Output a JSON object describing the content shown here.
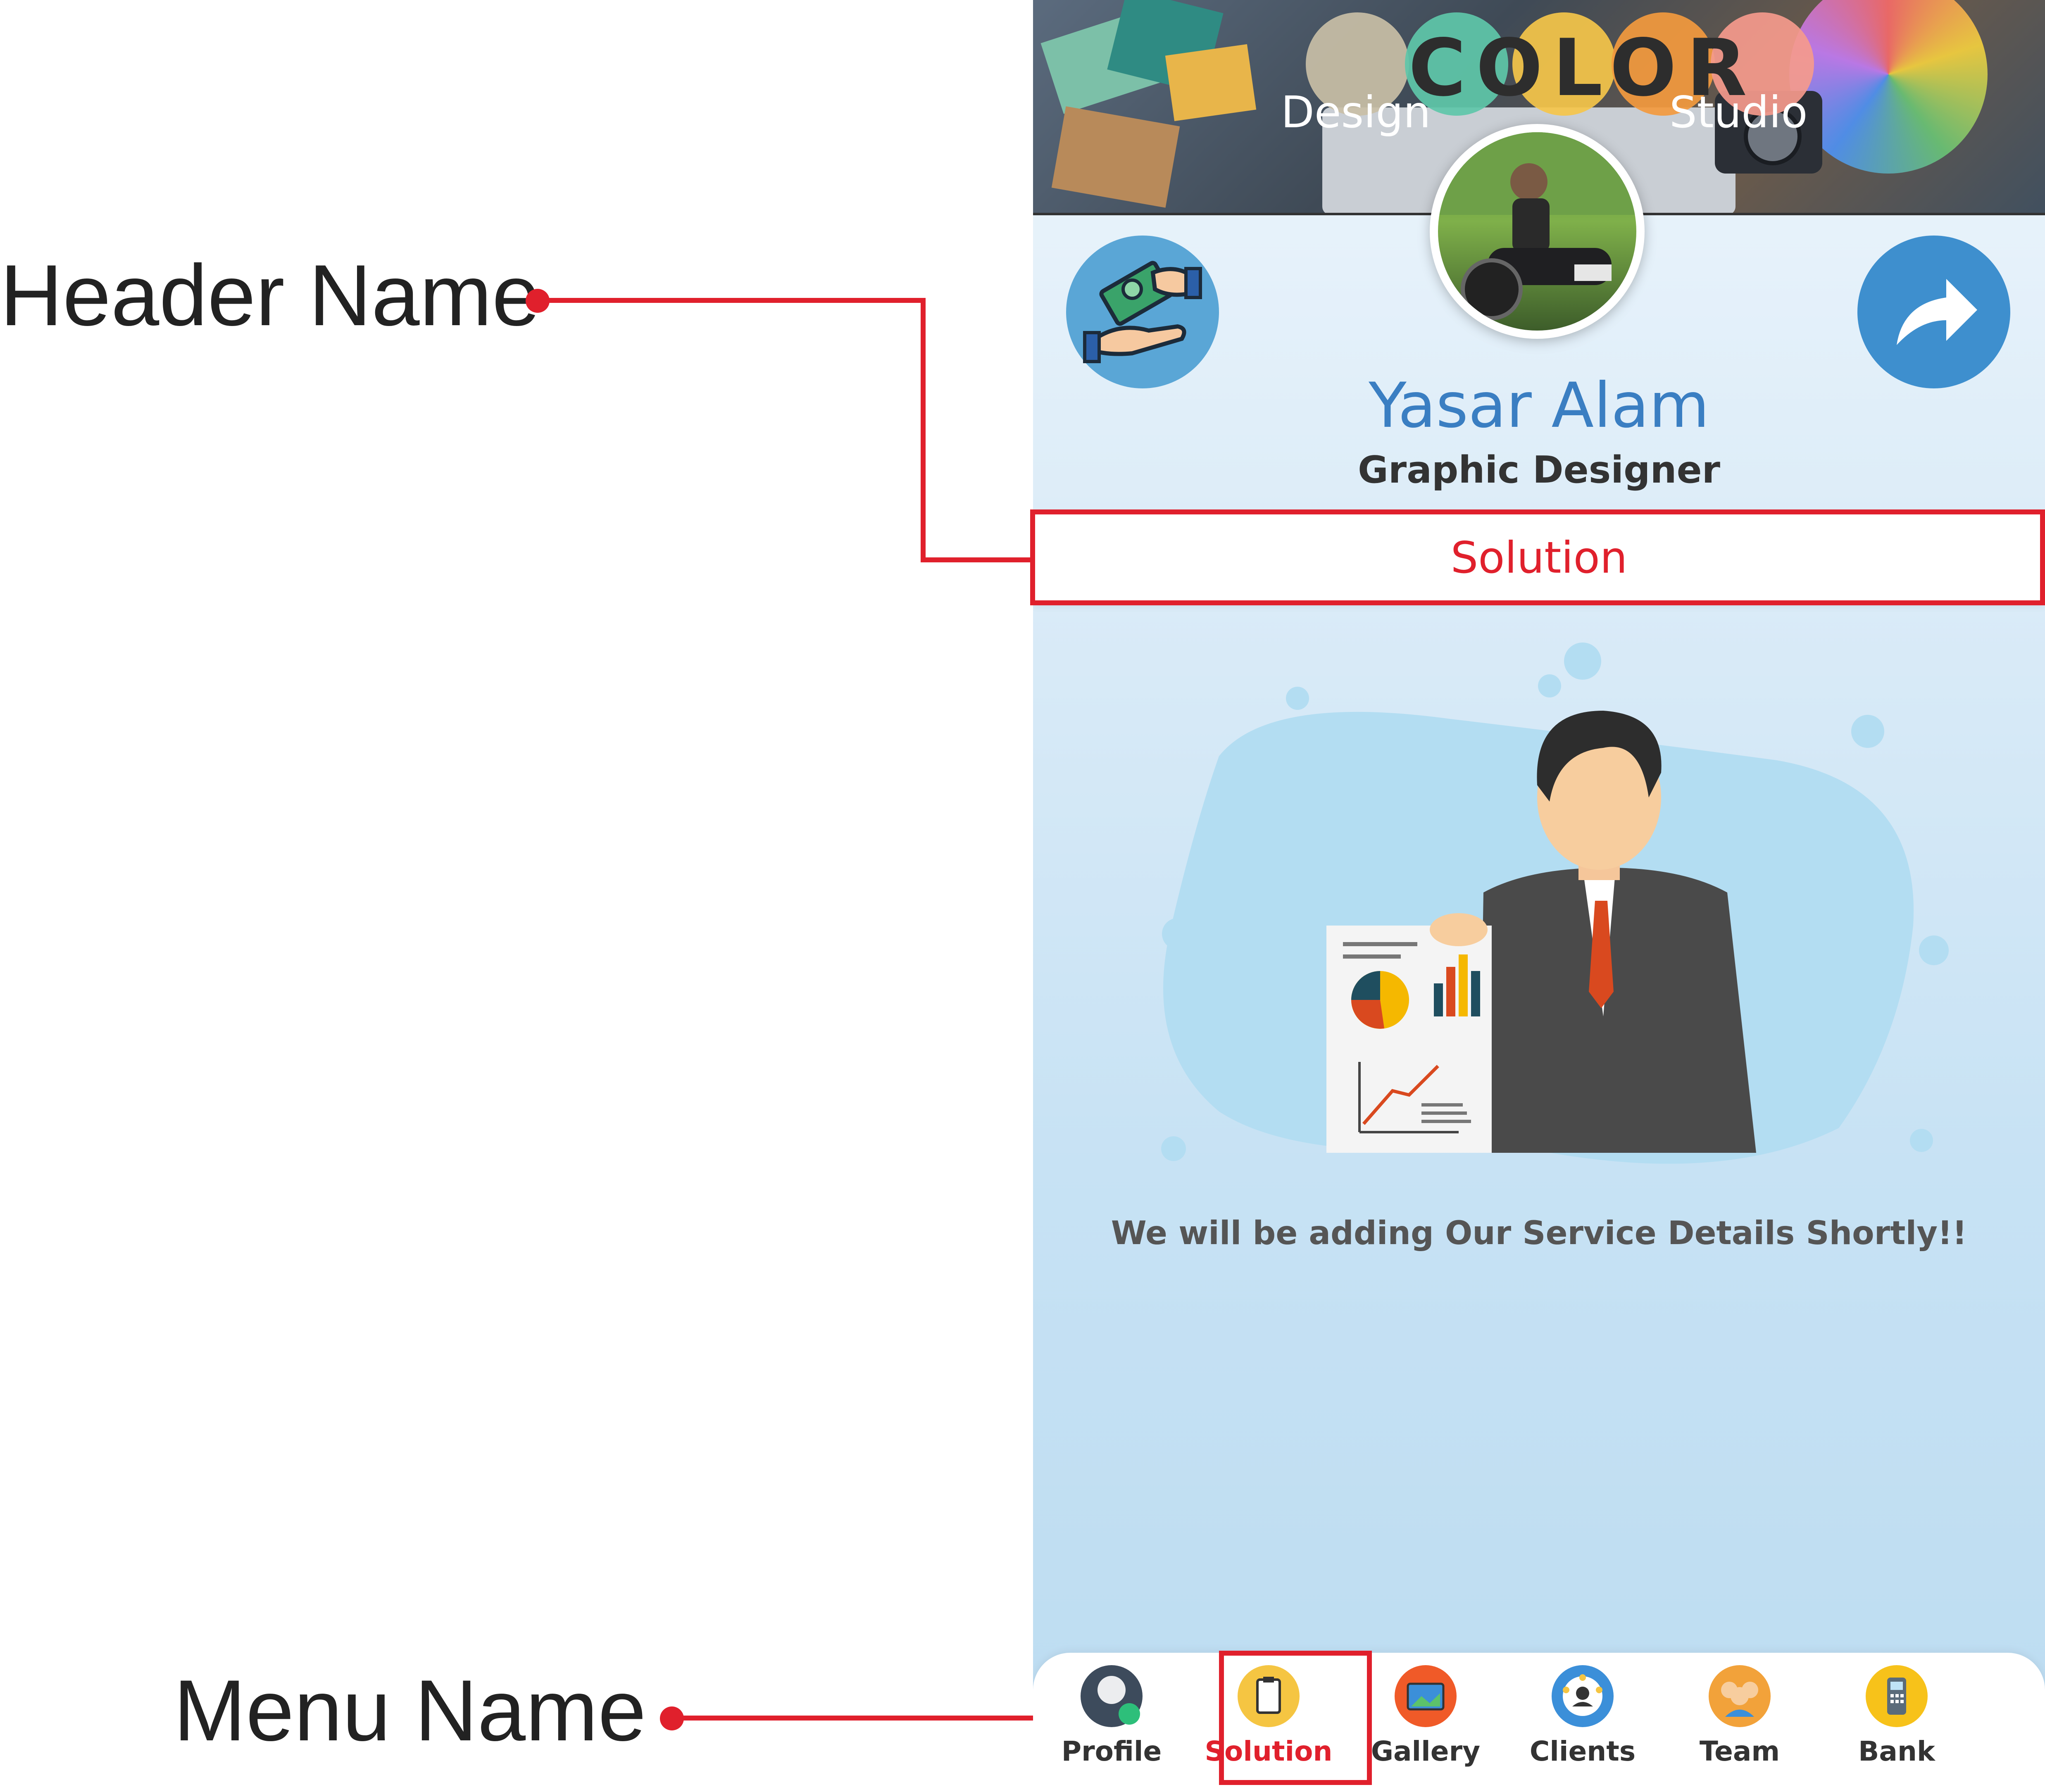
{
  "annotations": {
    "header_label": "Header Name",
    "menu_label": "Menu Name",
    "highlight_color": "#e0202c"
  },
  "banner": {
    "logo_word": "COLOR",
    "logo_sub_left": "Design",
    "logo_sub_right": "Studio"
  },
  "profile": {
    "name": "Yasar Alam",
    "title": "Graphic Designer",
    "left_button_icon": "hands-exchange-money-icon",
    "right_button_icon": "share-arrow-icon"
  },
  "section": {
    "header": "Solution",
    "empty_message": "We will be adding Our Service Details Shortly!!"
  },
  "bottom_nav": {
    "items": [
      {
        "label": "Profile",
        "icon": "profile-icon",
        "color": "#3d4b5c"
      },
      {
        "label": "Solution",
        "icon": "solution-icon",
        "color": "#f5c542",
        "active": true
      },
      {
        "label": "Gallery",
        "icon": "gallery-icon",
        "color": "#f05a28"
      },
      {
        "label": "Clients",
        "icon": "clients-icon",
        "color": "#3b8fd9"
      },
      {
        "label": "Team",
        "icon": "team-icon",
        "color": "#f2a23a"
      },
      {
        "label": "Bank",
        "icon": "bank-icon",
        "color": "#f7c21a"
      }
    ]
  },
  "colors": {
    "name_blue": "#3a7ec2",
    "accent_red": "#e0202c",
    "share_blue": "#3e8fce"
  }
}
